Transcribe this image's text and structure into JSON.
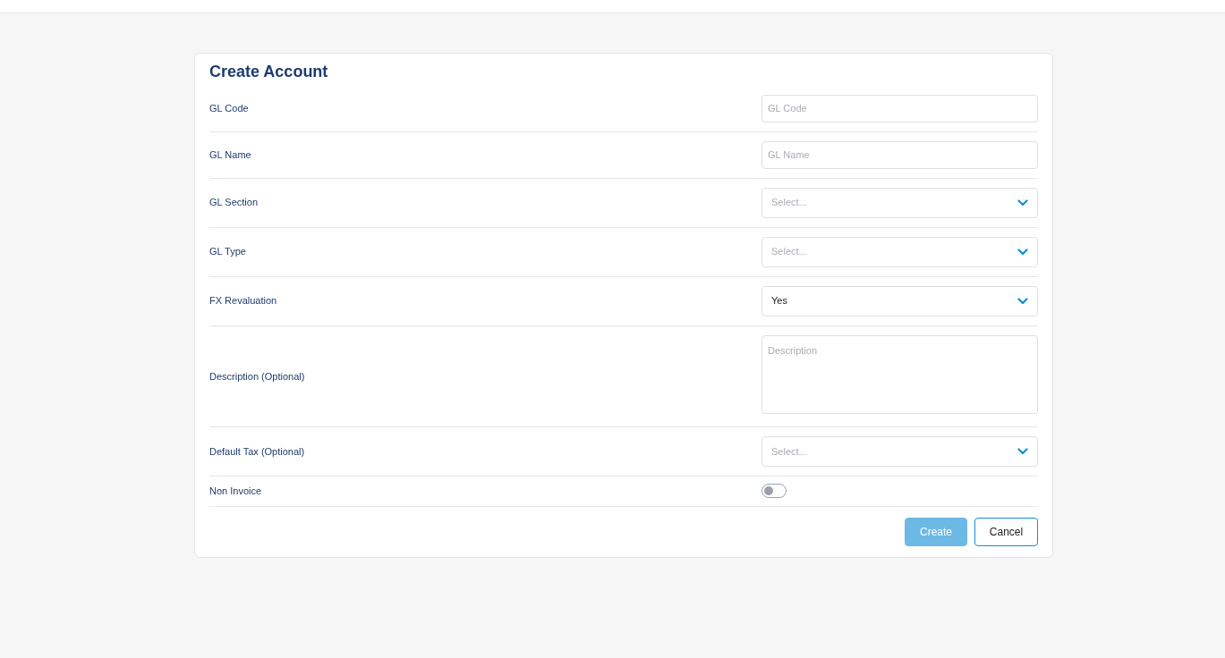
{
  "title": "Create Account",
  "fields": [
    {
      "kind": "text",
      "label": "GL Code",
      "placeholder": "GL Code"
    },
    {
      "kind": "text",
      "label": "GL Name",
      "placeholder": "GL Name"
    },
    {
      "kind": "select",
      "label": "GL Section",
      "placeholder": "Select..."
    },
    {
      "kind": "select",
      "label": "GL Type",
      "placeholder": "Select..."
    },
    {
      "kind": "select",
      "label": "FX Revaluation",
      "value": "Yes"
    },
    {
      "kind": "textarea",
      "label": "Description (Optional)",
      "placeholder": "Description"
    },
    {
      "kind": "select",
      "label": "Default Tax (Optional)",
      "placeholder": "Select..."
    },
    {
      "kind": "switch",
      "label": "Non Invoice",
      "on": false
    }
  ],
  "buttons": [
    {
      "kind": "primary",
      "label": "Create",
      "disabled": true
    },
    {
      "kind": "outline",
      "label": "Cancel",
      "disabled": false
    }
  ]
}
